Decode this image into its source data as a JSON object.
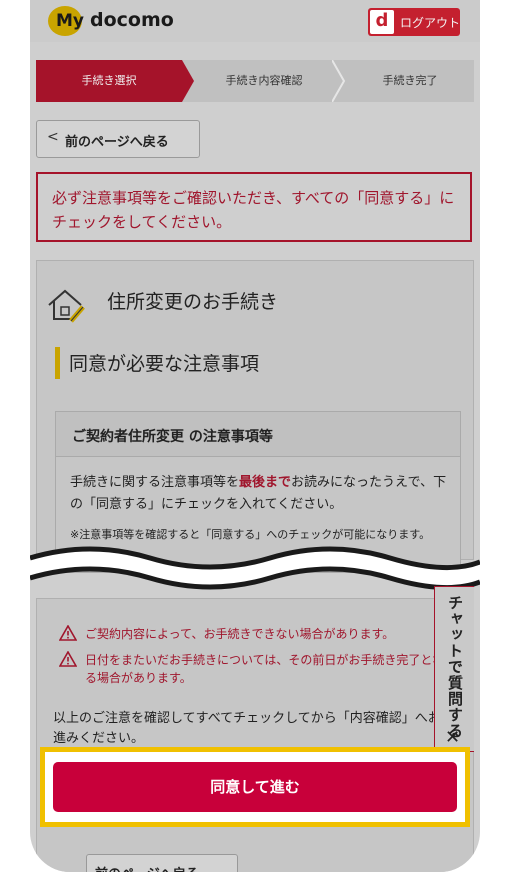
{
  "header": {
    "logo_my": "My",
    "logo_docomo": "docomo",
    "logout_d": "d",
    "logout_label": "ログアウト"
  },
  "steps": [
    {
      "label": "手続き選択",
      "active": true
    },
    {
      "label": "手続き内容確認",
      "active": false
    },
    {
      "label": "手続き完了",
      "active": false
    }
  ],
  "back_label": "前のページへ戻る",
  "alert_text": "必ず注意事項等をご確認いただき、すべての「同意する」にチェックをしてください。",
  "procedure_title": "住所変更のお手続き",
  "section_title": "同意が必要な注意事項",
  "notice": {
    "heading": "ご契約者住所変更 の注意事項等",
    "body_pre": "手続きに関する注意事項等を",
    "body_em": "最後まで",
    "body_post": "お読みになったうえで、下の「同意する」にチェックを入れてください。",
    "sub": "※注意事項等を確認すると「同意する」へのチェックが可能になります。"
  },
  "warnings": [
    "ご契約内容によって、お手続きできない場合があります。",
    "日付をまたいだお手続きについては、その前日がお手続き完了となる場合があります。"
  ],
  "confirm_text": "以上のご注意を確認してすべてチェックしてから「内容確認」へお進みください。",
  "chat": {
    "label": "チャットで質問する",
    "close": "✕"
  },
  "agree_button": "同意して進む",
  "back_label_bottom": "前のページへ戻る",
  "colors": {
    "brand_red": "#c8003a",
    "highlight": "#f0c000",
    "accent_yellow": "#c9a400"
  }
}
